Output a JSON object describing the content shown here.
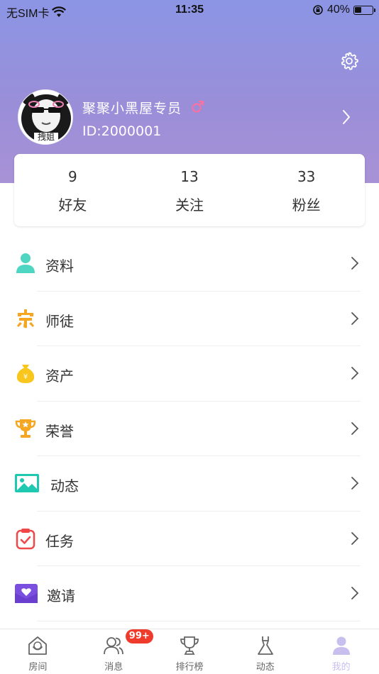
{
  "status_bar": {
    "carrier": "无SIM卡",
    "time": "11:35",
    "battery_percent": "40%",
    "battery_level": 0.4
  },
  "profile": {
    "avatar_caption": "拽姐",
    "nickname": "聚聚小黑屋专员",
    "user_id": "ID:2000001",
    "gender_color": "#ff6f9f"
  },
  "stats": [
    {
      "value": "9",
      "label": "好友"
    },
    {
      "value": "13",
      "label": "关注"
    },
    {
      "value": "33",
      "label": "粉丝"
    }
  ],
  "menu": [
    {
      "label": "资料",
      "icon": "person-icon"
    },
    {
      "label": "师徒",
      "icon": "mentor-icon"
    },
    {
      "label": "资产",
      "icon": "money-bag-icon"
    },
    {
      "label": "荣誉",
      "icon": "trophy-icon"
    },
    {
      "label": "动态",
      "icon": "image-icon"
    },
    {
      "label": "任务",
      "icon": "task-icon"
    },
    {
      "label": "邀请",
      "icon": "invite-icon"
    }
  ],
  "tabs": [
    {
      "label": "房间",
      "icon": "home-icon"
    },
    {
      "label": "消息",
      "icon": "messages-icon",
      "badge": "99+"
    },
    {
      "label": "排行榜",
      "icon": "trophy-icon"
    },
    {
      "label": "动态",
      "icon": "dress-icon"
    },
    {
      "label": "我的",
      "icon": "profile-icon"
    }
  ],
  "colors": {
    "header_gradient_top": "#8b95e4",
    "header_gradient_bottom": "#a892d6",
    "active_tab": "#c9bfee",
    "badge": "#ef3b2c"
  }
}
